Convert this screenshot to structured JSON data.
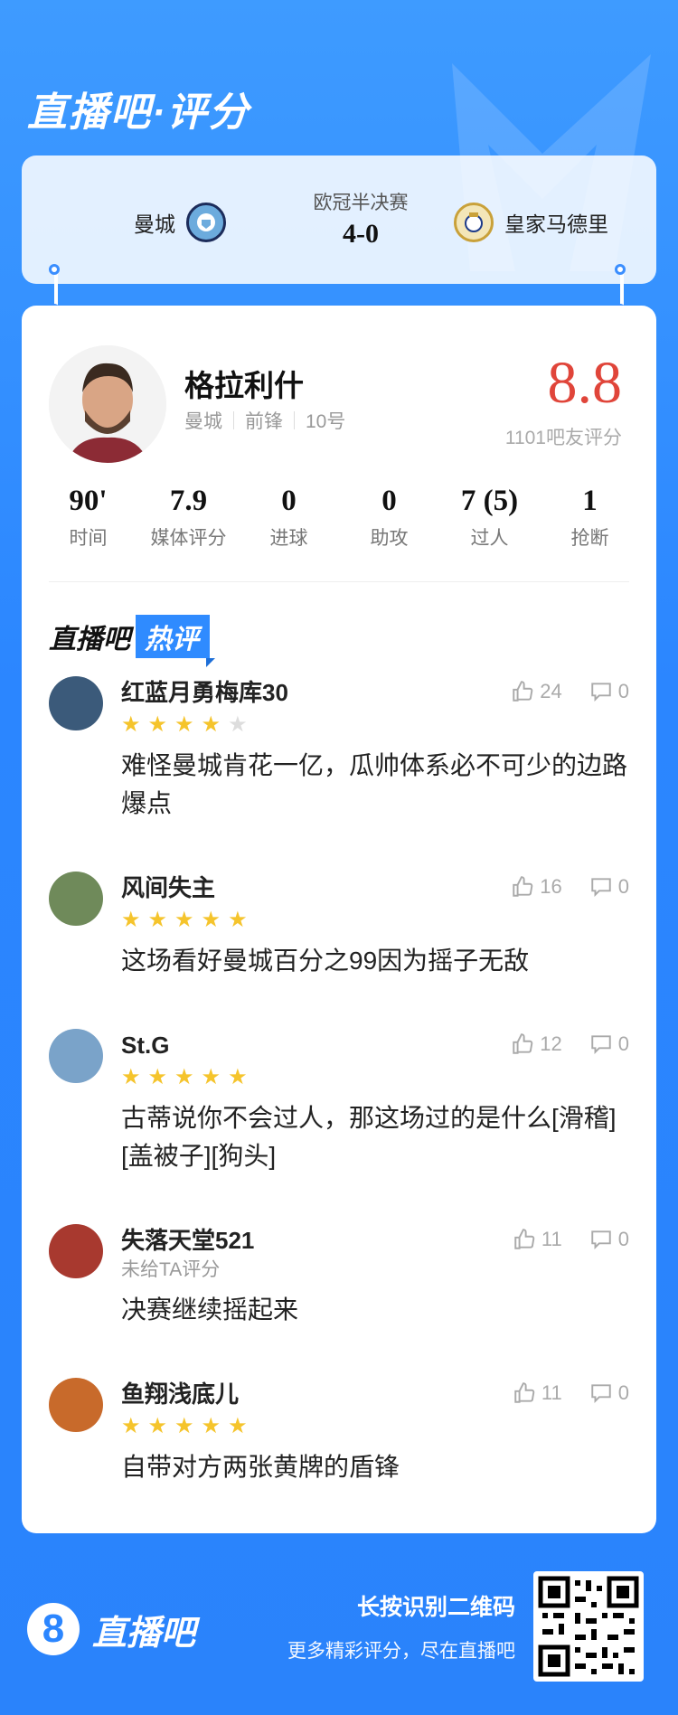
{
  "header": {
    "title": "直播吧·评分"
  },
  "match": {
    "home_team": "曼城",
    "away_team": "皇家马德里",
    "competition": "欧冠半决赛",
    "score": "4-0"
  },
  "player": {
    "name": "格拉利什",
    "club": "曼城",
    "position": "前锋",
    "number": "10号",
    "rating": "8.8",
    "rating_count": "1101吧友评分"
  },
  "stats": [
    {
      "value": "90'",
      "label": "时间"
    },
    {
      "value": "7.9",
      "label": "媒体评分"
    },
    {
      "value": "0",
      "label": "进球"
    },
    {
      "value": "0",
      "label": "助攻"
    },
    {
      "value": "7 (5)",
      "label": "过人"
    },
    {
      "value": "1",
      "label": "抢断"
    }
  ],
  "hot_comments": {
    "title": "直播吧",
    "badge": "热评",
    "items": [
      {
        "user": "红蓝月勇梅库30",
        "stars": 4,
        "likes": "24",
        "dislikes": "0",
        "text": "难怪曼城肯花一亿，瓜帅体系必不可少的边路爆点",
        "avatar_color": "#3b5a7a"
      },
      {
        "user": "风间失主",
        "stars": 5,
        "likes": "16",
        "dislikes": "0",
        "text": "这场看好曼城百分之99因为摇子无敌",
        "avatar_color": "#6f8a5a"
      },
      {
        "user": "St.G",
        "stars": 5,
        "likes": "12",
        "dislikes": "0",
        "text": "古蒂说你不会过人，那这场过的是什么[滑稽][盖被子][狗头]",
        "avatar_color": "#7aa3c9"
      },
      {
        "user": "失落天堂521",
        "unrated": "未给TA评分",
        "likes": "11",
        "dislikes": "0",
        "text": "决赛继续摇起来",
        "avatar_color": "#a8392f"
      },
      {
        "user": "鱼翔浅底儿",
        "stars": 5,
        "likes": "11",
        "dislikes": "0",
        "text": "自带对方两张黄牌的盾锋",
        "avatar_color": "#c86a2b"
      }
    ]
  },
  "footer": {
    "logo_digit": "8",
    "logo_text": "直播吧",
    "cta_primary": "长按识别二维码",
    "cta_secondary": "更多精彩评分，尽在直播吧"
  }
}
